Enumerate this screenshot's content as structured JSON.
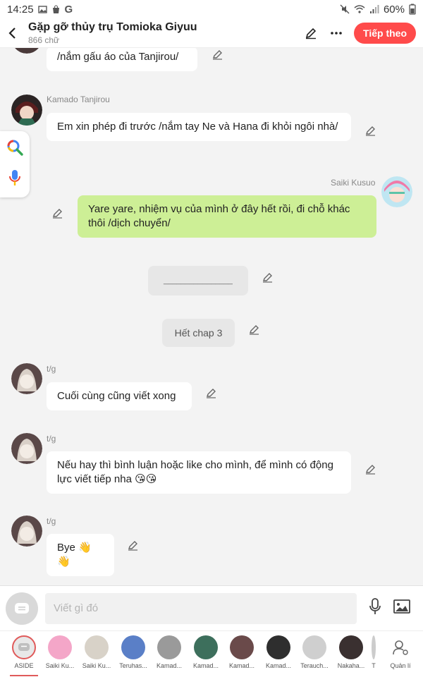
{
  "status": {
    "time": "14:25",
    "battery": "60%"
  },
  "header": {
    "title": "Gặp gỡ thủy trụ Tomioka Giyuu",
    "subtitle": "866 chữ",
    "next_label": "Tiếp theo"
  },
  "messages": [
    {
      "sender": "",
      "text": "/nắm gấu áo của Tanjirou/"
    },
    {
      "sender": "Kamado Tanjirou",
      "text": "Em xin phép đi trước /nắm tay Ne và Hana đi khỏi ngôi nhà/"
    },
    {
      "sender": "Saiki Kusuo",
      "text": "Yare yare, nhiệm vụ của mình ở đây hết rồi, đi chỗ khác thôi /dịch chuyển/"
    },
    {
      "sender": "",
      "text": "________________"
    },
    {
      "sender": "",
      "text": "Hết chap 3"
    },
    {
      "sender": "t/g",
      "text": "Cuối cùng cũng viết xong"
    },
    {
      "sender": "t/g",
      "text": "Nếu hay thì bình luận hoặc like cho mình, để mình có động lực viết tiếp nha 😘😘"
    },
    {
      "sender": "t/g",
      "text": "Bye 👋👋"
    }
  ],
  "input": {
    "placeholder": "Viết gì đó"
  },
  "characters": [
    {
      "label": "ASIDE",
      "color": "#e8e8e8"
    },
    {
      "label": "Saiki Ku...",
      "color": "#f4a6c8"
    },
    {
      "label": "Saiki Ku...",
      "color": "#d8d2c8"
    },
    {
      "label": "Teruhas...",
      "color": "#5a7fc7"
    },
    {
      "label": "Kamad...",
      "color": "#9a9a9a"
    },
    {
      "label": "Kamad...",
      "color": "#3d6f5c"
    },
    {
      "label": "Kamad...",
      "color": "#6a4a4a"
    },
    {
      "label": "Kamad...",
      "color": "#2e2e2e"
    },
    {
      "label": "Terauch...",
      "color": "#cfcfcf"
    },
    {
      "label": "Nakaha...",
      "color": "#3a3030"
    },
    {
      "label": "T",
      "color": "#cccccc"
    },
    {
      "label": "Quản lí",
      "color": "#ffffff"
    }
  ]
}
